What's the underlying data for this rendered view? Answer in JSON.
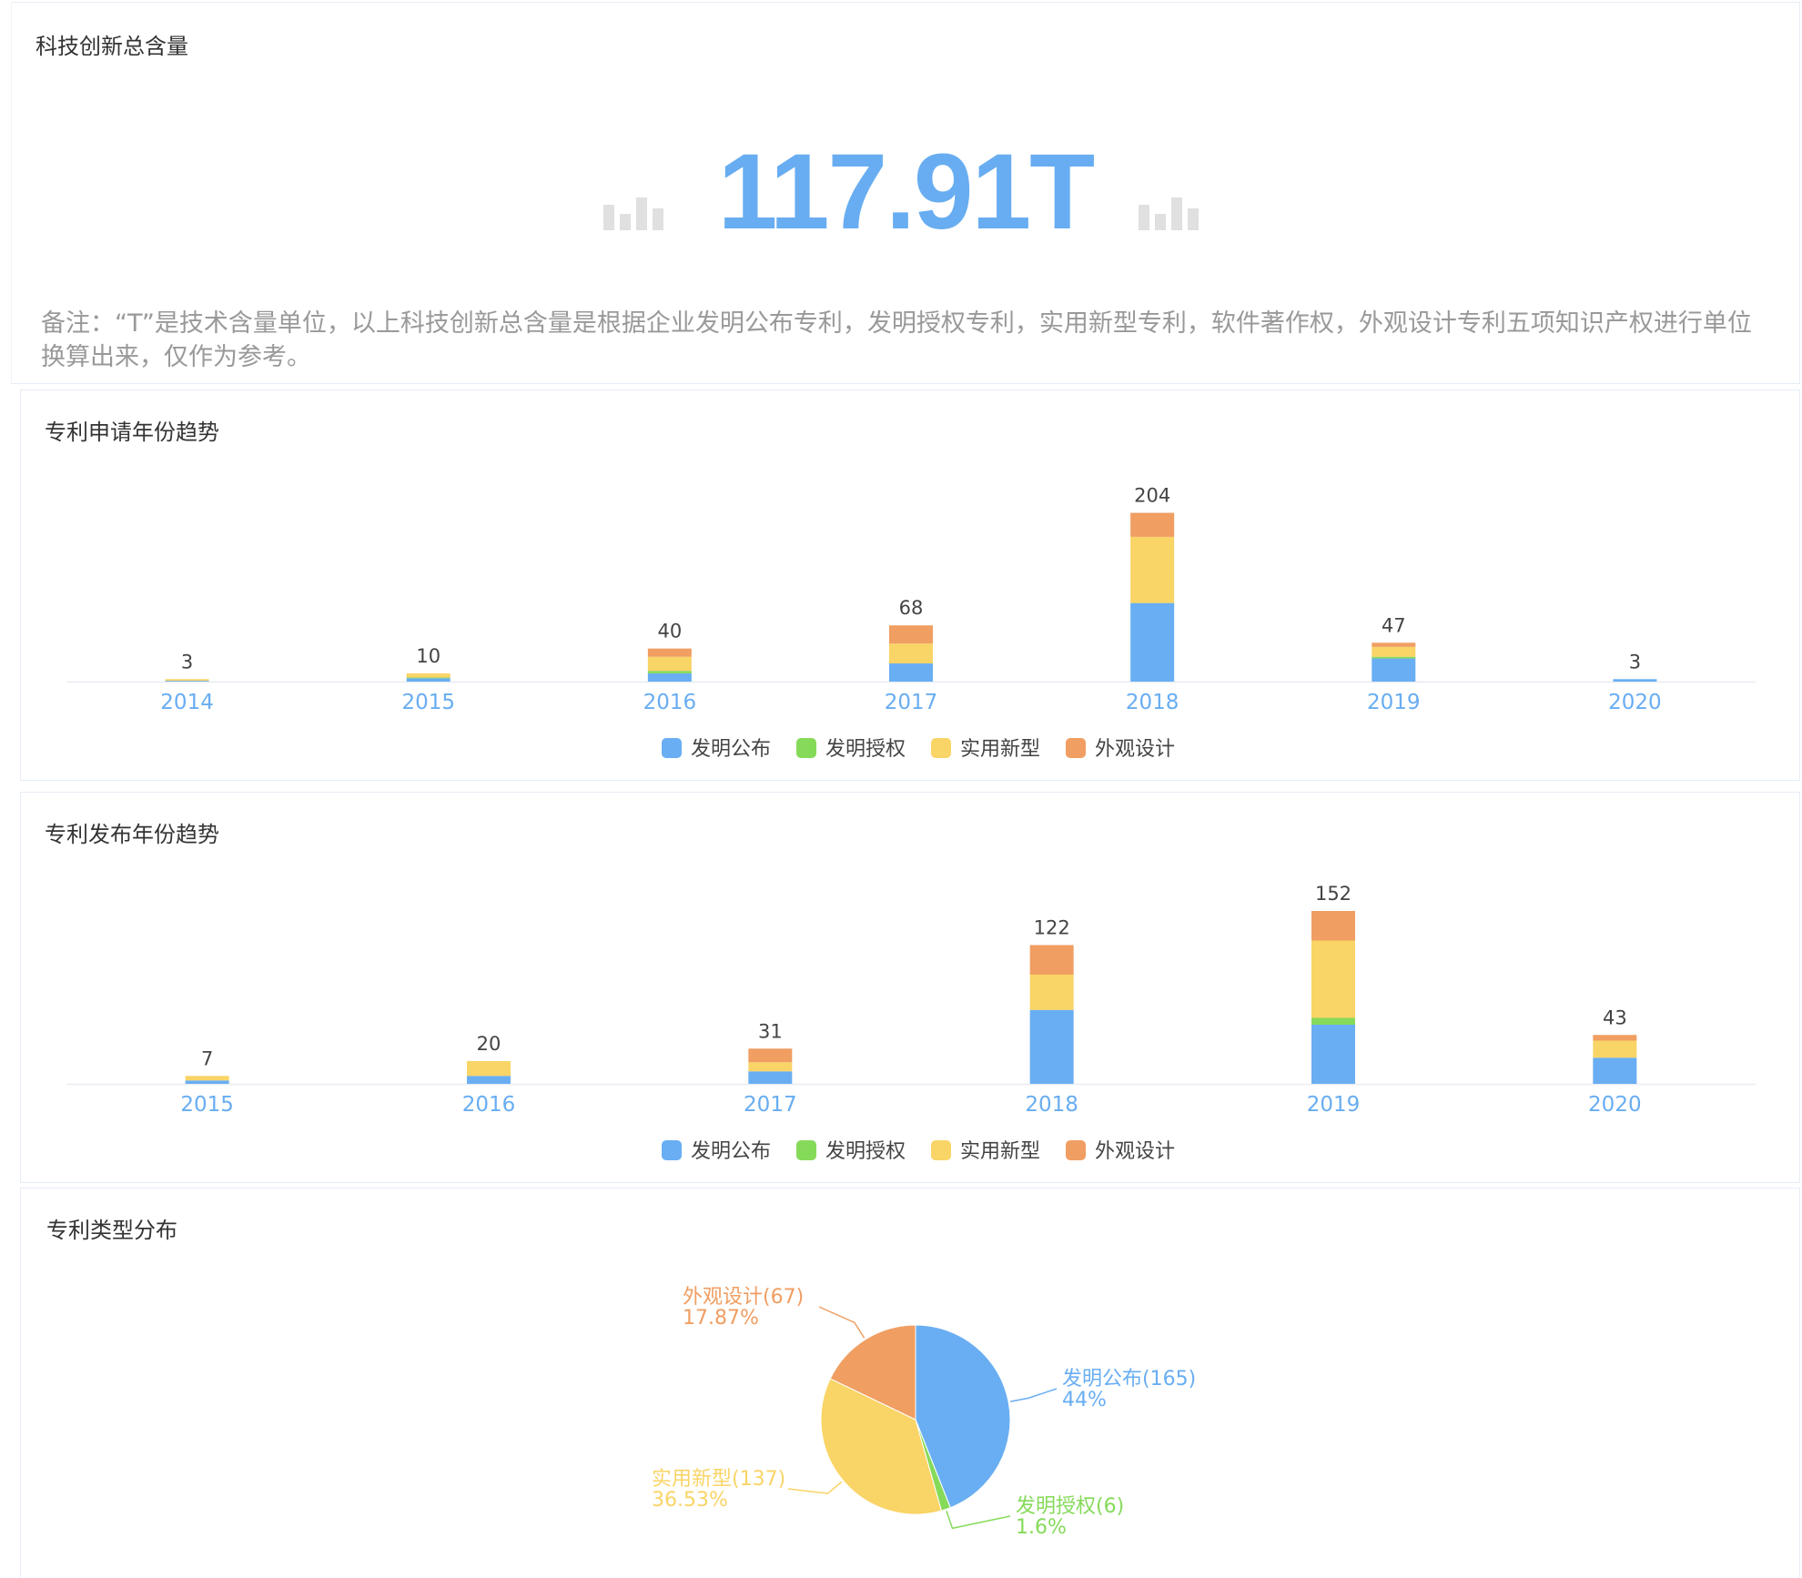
{
  "summary": {
    "title": "科技创新总含量",
    "value": "117.91T",
    "note": "备注：“T”是技术含量单位，以上科技创新总含量是根据企业发明公布专利，发明授权专利，实用新型专利，软件著作权，外观设计专利五项知识产权进行单位换算出来，仅作为参考。"
  },
  "colors": {
    "invention_publish": "#69aef2",
    "invention_grant": "#86da5a",
    "utility_model": "#f9d466",
    "design": "#f09e62"
  },
  "chart_data": [
    {
      "type": "bar",
      "stacked": true,
      "title": "专利申请年份趋势",
      "categories": [
        "2014",
        "2015",
        "2016",
        "2017",
        "2018",
        "2019",
        "2020"
      ],
      "totals": [
        3,
        10,
        40,
        68,
        204,
        47,
        3
      ],
      "series": [
        {
          "name": "发明公布",
          "values": [
            1,
            4,
            10,
            22,
            95,
            28,
            3
          ]
        },
        {
          "name": "发明授权",
          "values": [
            0,
            1,
            3,
            0,
            0,
            2,
            0
          ]
        },
        {
          "name": "实用新型",
          "values": [
            2,
            5,
            17,
            24,
            80,
            12,
            0
          ]
        },
        {
          "name": "外观设计",
          "values": [
            0,
            0,
            10,
            22,
            29,
            5,
            0
          ]
        }
      ],
      "legend": "bottom-center",
      "ylim": [
        0,
        220
      ]
    },
    {
      "type": "bar",
      "stacked": true,
      "title": "专利发布年份趋势",
      "categories": [
        "2015",
        "2016",
        "2017",
        "2018",
        "2019",
        "2020"
      ],
      "totals": [
        7,
        20,
        31,
        122,
        152,
        43
      ],
      "series": [
        {
          "name": "发明公布",
          "values": [
            3,
            7,
            11,
            65,
            52,
            23
          ]
        },
        {
          "name": "发明授权",
          "values": [
            0,
            0,
            0,
            0,
            6,
            0
          ]
        },
        {
          "name": "实用新型",
          "values": [
            4,
            13,
            8,
            31,
            68,
            15
          ]
        },
        {
          "name": "外观设计",
          "values": [
            0,
            0,
            12,
            26,
            26,
            5
          ]
        }
      ],
      "legend": "bottom-center",
      "ylim": [
        0,
        160
      ]
    },
    {
      "type": "pie",
      "title": "专利类型分布",
      "slices": [
        {
          "name": "发明公布",
          "value": 165,
          "percent": "44%",
          "label": "发明公布(165)"
        },
        {
          "name": "发明授权",
          "value": 6,
          "percent": "1.6%",
          "label": "发明授权(6)"
        },
        {
          "name": "实用新型",
          "value": 137,
          "percent": "36.53%",
          "label": "实用新型(137)"
        },
        {
          "name": "外观设计",
          "value": 67,
          "percent": "17.87%",
          "label": "外观设计(67)"
        }
      ]
    }
  ]
}
